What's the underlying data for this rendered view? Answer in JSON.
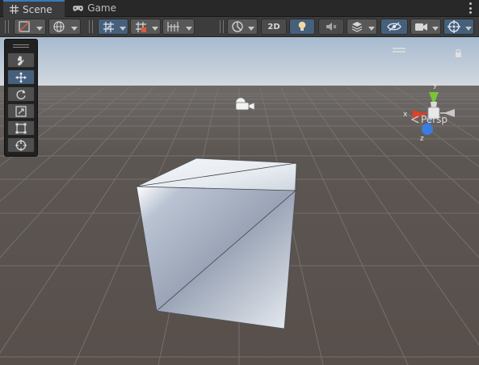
{
  "tabs": [
    {
      "label": "Scene",
      "icon": "grid-icon",
      "active": true
    },
    {
      "label": "Game",
      "icon": "gamepad-icon",
      "active": false
    }
  ],
  "toolbar": {
    "draw_mode_icon": "shaded-draw-mode-icon",
    "global_icon": "global-pivot-icon",
    "grid_snap_icon": "grid-snap-icon",
    "increment_snap_icon": "increment-snap-icon",
    "snap_icon": "snap-settings-icon",
    "render_icon": "render-mode-icon",
    "toggle_2d_label": "2D",
    "lighting_icon": "lighting-icon",
    "audio_icon": "audio-mute-icon",
    "effects_icon": "effects-icon",
    "visibility_icon": "hidden-objects-icon",
    "camera_icon": "camera-icon",
    "gizmos_icon": "gizmos-icon"
  },
  "tools": [
    {
      "name": "hand-tool",
      "icon": "hand-icon",
      "active": false
    },
    {
      "name": "move-tool",
      "icon": "move-icon",
      "active": true
    },
    {
      "name": "rotate-tool",
      "icon": "rotate-icon",
      "active": false
    },
    {
      "name": "scale-tool",
      "icon": "scale-icon",
      "active": false
    },
    {
      "name": "rect-tool",
      "icon": "rect-transform-icon",
      "active": false
    },
    {
      "name": "transform-tool",
      "icon": "transform-icon",
      "active": false
    }
  ],
  "gizmo": {
    "axis_y": "y",
    "axis_x": "x",
    "axis_z": "z",
    "projection_label": "Persp"
  },
  "colors": {
    "sky_top": "#a6bad0",
    "horizon": "#d9dde1",
    "ground": "#5a5450",
    "accent": "#3a79bb",
    "axis_x": "#e0402a",
    "axis_y": "#7ac43a",
    "axis_z": "#3a7de0"
  }
}
